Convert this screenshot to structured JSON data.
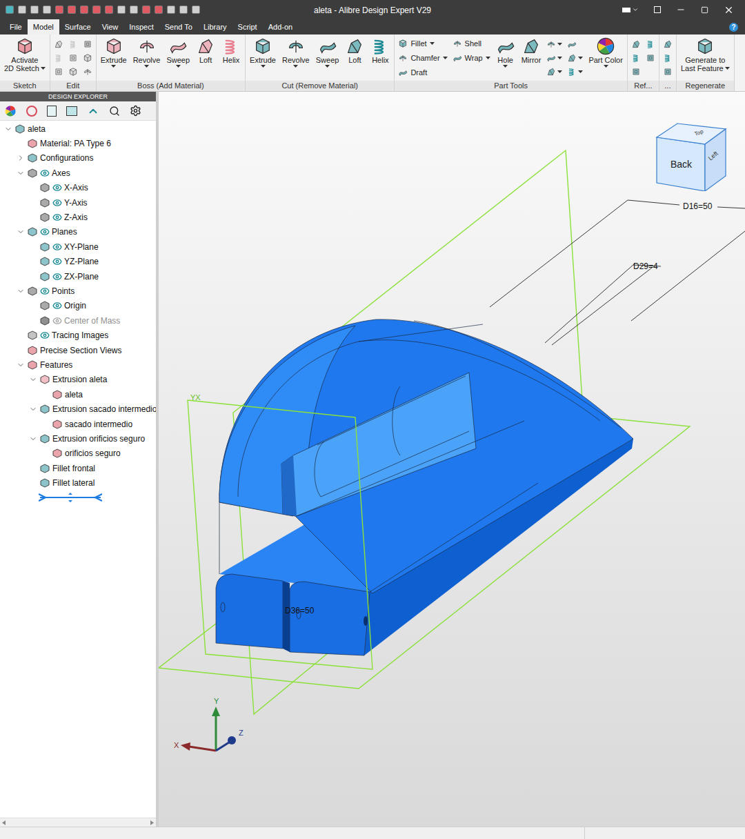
{
  "window": {
    "title": "aleta - Alibre Design Expert V29",
    "help_icon": "?"
  },
  "menu_tabs": [
    {
      "label": "File",
      "selected": false
    },
    {
      "label": "Model",
      "selected": true
    },
    {
      "label": "Surface",
      "selected": false
    },
    {
      "label": "View",
      "selected": false
    },
    {
      "label": "Inspect",
      "selected": false
    },
    {
      "label": "Send To",
      "selected": false
    },
    {
      "label": "Library",
      "selected": false
    },
    {
      "label": "Script",
      "selected": false
    },
    {
      "label": "Add-on",
      "selected": false
    }
  ],
  "ribbon": {
    "groups": [
      {
        "label": "Sketch",
        "items": [
          {
            "kind": "large",
            "lines": [
              "Activate",
              "2D Sketch"
            ],
            "dropdown": true
          }
        ]
      },
      {
        "label": "Edit",
        "items": [
          {
            "kind": "icon-column",
            "entries": [
              {
                "dropdown": false,
                "disabled": true
              },
              {
                "dropdown": false,
                "disabled": true
              },
              {
                "dropdown": false,
                "disabled": true
              }
            ]
          },
          {
            "kind": "icon-column",
            "entries": [
              {
                "dropdown": false,
                "disabled": true
              },
              {
                "dropdown": false,
                "disabled": true
              },
              {
                "dropdown": false,
                "disabled": true
              }
            ]
          },
          {
            "kind": "icon-column",
            "entries": [
              {
                "dropdown": false,
                "disabled": false
              },
              {
                "dropdown": false,
                "disabled": true
              },
              {
                "dropdown": false,
                "disabled": true
              }
            ]
          }
        ]
      },
      {
        "label": "Boss (Add Material)",
        "items": [
          {
            "kind": "large",
            "lines": [
              "Extrude"
            ],
            "dropdown": true
          },
          {
            "kind": "large",
            "lines": [
              "Revolve"
            ],
            "dropdown": true
          },
          {
            "kind": "large",
            "lines": [
              "Sweep"
            ],
            "dropdown": true
          },
          {
            "kind": "large",
            "lines": [
              "Loft"
            ],
            "dropdown": false
          },
          {
            "kind": "large",
            "lines": [
              "Helix"
            ],
            "dropdown": false
          }
        ]
      },
      {
        "label": "Cut (Remove Material)",
        "items": [
          {
            "kind": "large",
            "lines": [
              "Extrude"
            ],
            "dropdown": true
          },
          {
            "kind": "large",
            "lines": [
              "Revolve"
            ],
            "dropdown": true
          },
          {
            "kind": "large",
            "lines": [
              "Sweep"
            ],
            "dropdown": true
          },
          {
            "kind": "large",
            "lines": [
              "Loft"
            ],
            "dropdown": false
          },
          {
            "kind": "large",
            "lines": [
              "Helix"
            ],
            "dropdown": false
          }
        ]
      },
      {
        "label": "Part Tools",
        "items": [
          {
            "kind": "small-column",
            "entries": [
              {
                "label": "Fillet",
                "dropdown": true
              },
              {
                "label": "Chamfer",
                "dropdown": true
              },
              {
                "label": "Draft",
                "dropdown": false
              }
            ]
          },
          {
            "kind": "small-column",
            "entries": [
              {
                "label": "Shell",
                "dropdown": false
              },
              {
                "label": "Wrap",
                "dropdown": true
              }
            ]
          },
          {
            "kind": "large",
            "lines": [
              "Hole"
            ],
            "dropdown": true
          },
          {
            "kind": "large",
            "lines": [
              "Mirror"
            ],
            "dropdown": false
          },
          {
            "kind": "icon-column",
            "entries": [
              {
                "dropdown": true,
                "disabled": false
              },
              {
                "dropdown": true,
                "disabled": false
              },
              {
                "dropdown": true,
                "disabled": false
              }
            ]
          },
          {
            "kind": "icon-column",
            "entries": [
              {
                "dropdown": false,
                "disabled": false
              },
              {
                "dropdown": true,
                "disabled": false
              },
              {
                "dropdown": true,
                "disabled": false
              }
            ]
          },
          {
            "kind": "large",
            "lines": [
              "Part Color"
            ],
            "dropdown": true
          }
        ]
      },
      {
        "label": "Ref...",
        "items": [
          {
            "kind": "icon-column",
            "entries": [
              {
                "dropdown": false,
                "disabled": false
              },
              {
                "dropdown": false,
                "disabled": false
              },
              {
                "dropdown": false,
                "disabled": false
              }
            ]
          },
          {
            "kind": "icon-column",
            "entries": [
              {
                "dropdown": false,
                "disabled": false
              },
              {
                "dropdown": false,
                "disabled": false
              }
            ]
          }
        ]
      },
      {
        "label": "...",
        "items": [
          {
            "kind": "icon-column",
            "entries": [
              {
                "dropdown": false,
                "disabled": false
              },
              {
                "dropdown": false,
                "disabled": false
              },
              {
                "dropdown": false,
                "disabled": false
              }
            ]
          }
        ]
      },
      {
        "label": "Regenerate",
        "items": [
          {
            "kind": "large",
            "lines": [
              "Generate to",
              "Last Feature"
            ],
            "dropdown": true
          }
        ]
      }
    ]
  },
  "design_explorer": {
    "title": "DESIGN EXPLORER"
  },
  "tree": [
    {
      "kind": "item",
      "label": "aleta",
      "depth": 0,
      "expandable": true,
      "expanded": true,
      "eye": false,
      "eye_on": false,
      "disabled": false
    },
    {
      "kind": "item",
      "label": "Material: PA Type 6",
      "depth": 1,
      "expandable": false,
      "expanded": false,
      "eye": false,
      "eye_on": false,
      "disabled": false
    },
    {
      "kind": "item",
      "label": "Configurations",
      "depth": 1,
      "expandable": true,
      "expanded": false,
      "eye": false,
      "eye_on": false,
      "disabled": false
    },
    {
      "kind": "item",
      "label": "Axes",
      "depth": 1,
      "expandable": true,
      "expanded": true,
      "eye": true,
      "eye_on": true,
      "disabled": false
    },
    {
      "kind": "item",
      "label": "X-Axis",
      "depth": 2,
      "expandable": false,
      "expanded": false,
      "eye": true,
      "eye_on": true,
      "disabled": false
    },
    {
      "kind": "item",
      "label": "Y-Axis",
      "depth": 2,
      "expandable": false,
      "expanded": false,
      "eye": true,
      "eye_on": true,
      "disabled": false
    },
    {
      "kind": "item",
      "label": "Z-Axis",
      "depth": 2,
      "expandable": false,
      "expanded": false,
      "eye": true,
      "eye_on": true,
      "disabled": false
    },
    {
      "kind": "item",
      "label": "Planes",
      "depth": 1,
      "expandable": true,
      "expanded": true,
      "eye": true,
      "eye_on": true,
      "disabled": false
    },
    {
      "kind": "item",
      "label": "XY-Plane",
      "depth": 2,
      "expandable": false,
      "expanded": false,
      "eye": true,
      "eye_on": true,
      "disabled": false
    },
    {
      "kind": "item",
      "label": "YZ-Plane",
      "depth": 2,
      "expandable": false,
      "expanded": false,
      "eye": true,
      "eye_on": true,
      "disabled": false
    },
    {
      "kind": "item",
      "label": "ZX-Plane",
      "depth": 2,
      "expandable": false,
      "expanded": false,
      "eye": true,
      "eye_on": true,
      "disabled": false
    },
    {
      "kind": "item",
      "label": "Points",
      "depth": 1,
      "expandable": true,
      "expanded": true,
      "eye": true,
      "eye_on": true,
      "disabled": false
    },
    {
      "kind": "item",
      "label": "Origin",
      "depth": 2,
      "expandable": false,
      "expanded": false,
      "eye": true,
      "eye_on": true,
      "disabled": false
    },
    {
      "kind": "item",
      "label": "Center of Mass",
      "depth": 2,
      "expandable": false,
      "expanded": false,
      "eye": true,
      "eye_on": false,
      "disabled": true
    },
    {
      "kind": "item",
      "label": "Tracing Images",
      "depth": 1,
      "expandable": false,
      "expanded": false,
      "eye": true,
      "eye_on": true,
      "disabled": false
    },
    {
      "kind": "item",
      "label": "Precise Section Views",
      "depth": 1,
      "expandable": false,
      "expanded": false,
      "eye": false,
      "eye_on": false,
      "disabled": false
    },
    {
      "kind": "item",
      "label": "Features",
      "depth": 1,
      "expandable": true,
      "expanded": true,
      "eye": false,
      "eye_on": false,
      "disabled": false
    },
    {
      "kind": "item",
      "label": "Extrusion aleta",
      "depth": 2,
      "expandable": true,
      "expanded": true,
      "eye": false,
      "eye_on": false,
      "disabled": false
    },
    {
      "kind": "item",
      "label": "aleta",
      "depth": 3,
      "expandable": false,
      "expanded": false,
      "eye": false,
      "eye_on": false,
      "disabled": false
    },
    {
      "kind": "item",
      "label": "Extrusion sacado intermedio",
      "depth": 2,
      "expandable": true,
      "expanded": true,
      "eye": false,
      "eye_on": false,
      "disabled": false
    },
    {
      "kind": "item",
      "label": "sacado intermedio",
      "depth": 3,
      "expandable": false,
      "expanded": false,
      "eye": false,
      "eye_on": false,
      "disabled": false
    },
    {
      "kind": "item",
      "label": "Extrusion orificios seguro",
      "depth": 2,
      "expandable": true,
      "expanded": true,
      "eye": false,
      "eye_on": false,
      "disabled": false
    },
    {
      "kind": "item",
      "label": "orificios seguro",
      "depth": 3,
      "expandable": false,
      "expanded": false,
      "eye": false,
      "eye_on": false,
      "disabled": false
    },
    {
      "kind": "item",
      "label": "Fillet frontal",
      "depth": 2,
      "expandable": false,
      "expanded": false,
      "eye": false,
      "eye_on": false,
      "disabled": false
    },
    {
      "kind": "item",
      "label": "Fillet lateral",
      "depth": 2,
      "expandable": false,
      "expanded": false,
      "eye": false,
      "eye_on": false,
      "disabled": false
    },
    {
      "kind": "rollback",
      "label": "",
      "depth": 2,
      "expandable": false,
      "expanded": false,
      "eye": false,
      "eye_on": false,
      "disabled": false
    }
  ],
  "canvas": {
    "dimensions": [
      {
        "label": "D16=50"
      },
      {
        "label": "D29=4"
      },
      {
        "label": "D36=50"
      }
    ],
    "plane_label": "YX",
    "view_cube": {
      "front": "Back",
      "top": "Top",
      "side": "Left"
    },
    "triad": {
      "x": "X",
      "y": "Y",
      "z": "Z"
    }
  }
}
